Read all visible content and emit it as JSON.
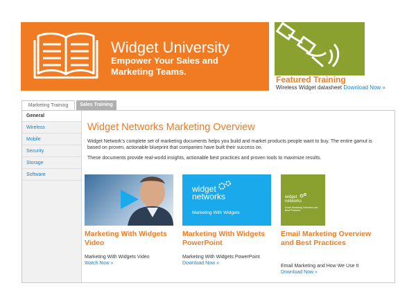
{
  "banner": {
    "title": "Widget University",
    "subtitle": "Empower Your Sales and Marketing Teams.",
    "icon": "book-icon",
    "color": "#f07b22"
  },
  "featured": {
    "heading": "Featured Training",
    "text": "Wireless Widget datasheet",
    "link": "Download Now »",
    "image_icon": "satellite-icon"
  },
  "tabs": [
    {
      "label": "Marketing Training",
      "active": true
    },
    {
      "label": "Sales Training",
      "active": false
    }
  ],
  "sidebar": {
    "items": [
      {
        "label": "General",
        "active": true
      },
      {
        "label": "Wireless"
      },
      {
        "label": "Mobile"
      },
      {
        "label": "Security"
      },
      {
        "label": "Storage"
      },
      {
        "label": "Software"
      }
    ]
  },
  "main": {
    "title": "Widget Networks Marketing Overview",
    "paragraph1": "Widget Network's complete set of marketing documents helps you build and market products people want to buy. The entire gamut is based on proven, actionable blueprint that companies have built their success on.",
    "paragraph2": "These documents provide real-world insights, actionable best practices and proven tools to maximize results."
  },
  "cards": [
    {
      "title": "Marketing With Widgets Video",
      "text": "Marketing With Widgets Video",
      "link": "Watch Now »"
    },
    {
      "title": "Marketing With Widgets PowerPoint",
      "text": "Marketing With Widgets PowerPoint",
      "link": "Download Now »",
      "thumb_brand_line1": "widget",
      "thumb_brand_line2": "networks",
      "thumb_caption": "Marketing With Widgets"
    },
    {
      "title": "Email Marketing Overview and Best Practices",
      "text": "Email Marketing and How We Use It",
      "link": "Download Now »",
      "thumb_brand_line1": "widget",
      "thumb_brand_line2": "networks",
      "thumb_caption": "Email Marketing Overview and Best Practices"
    }
  ]
}
